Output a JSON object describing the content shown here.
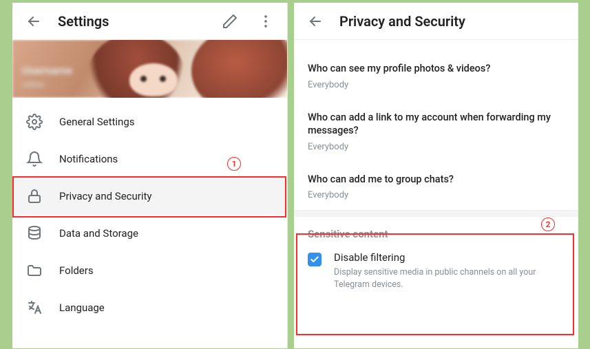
{
  "annotations": {
    "badge1": "1",
    "badge2": "2"
  },
  "left": {
    "title": "Settings",
    "profile": {
      "name": "Username",
      "status": "online"
    },
    "items": [
      {
        "icon": "gear",
        "label": "General Settings"
      },
      {
        "icon": "bell",
        "label": "Notifications"
      },
      {
        "icon": "lock",
        "label": "Privacy and Security",
        "selected": true
      },
      {
        "icon": "db",
        "label": "Data and Storage"
      },
      {
        "icon": "folder",
        "label": "Folders"
      },
      {
        "icon": "lang",
        "label": "Language"
      }
    ]
  },
  "right": {
    "title": "Privacy and Security",
    "privacy": [
      {
        "question": "Who can see my profile photos & videos?",
        "value": "Everybody"
      },
      {
        "question": "Who can add a link to my account when forwarding my messages?",
        "value": "Everybody"
      },
      {
        "question": "Who can add me to group chats?",
        "value": "Everybody"
      }
    ],
    "section": {
      "title": "Sensitive content",
      "checkbox": {
        "checked": true,
        "label": "Disable filtering",
        "desc": "Display sensitive media in public channels on all your Telegram devices."
      }
    }
  }
}
